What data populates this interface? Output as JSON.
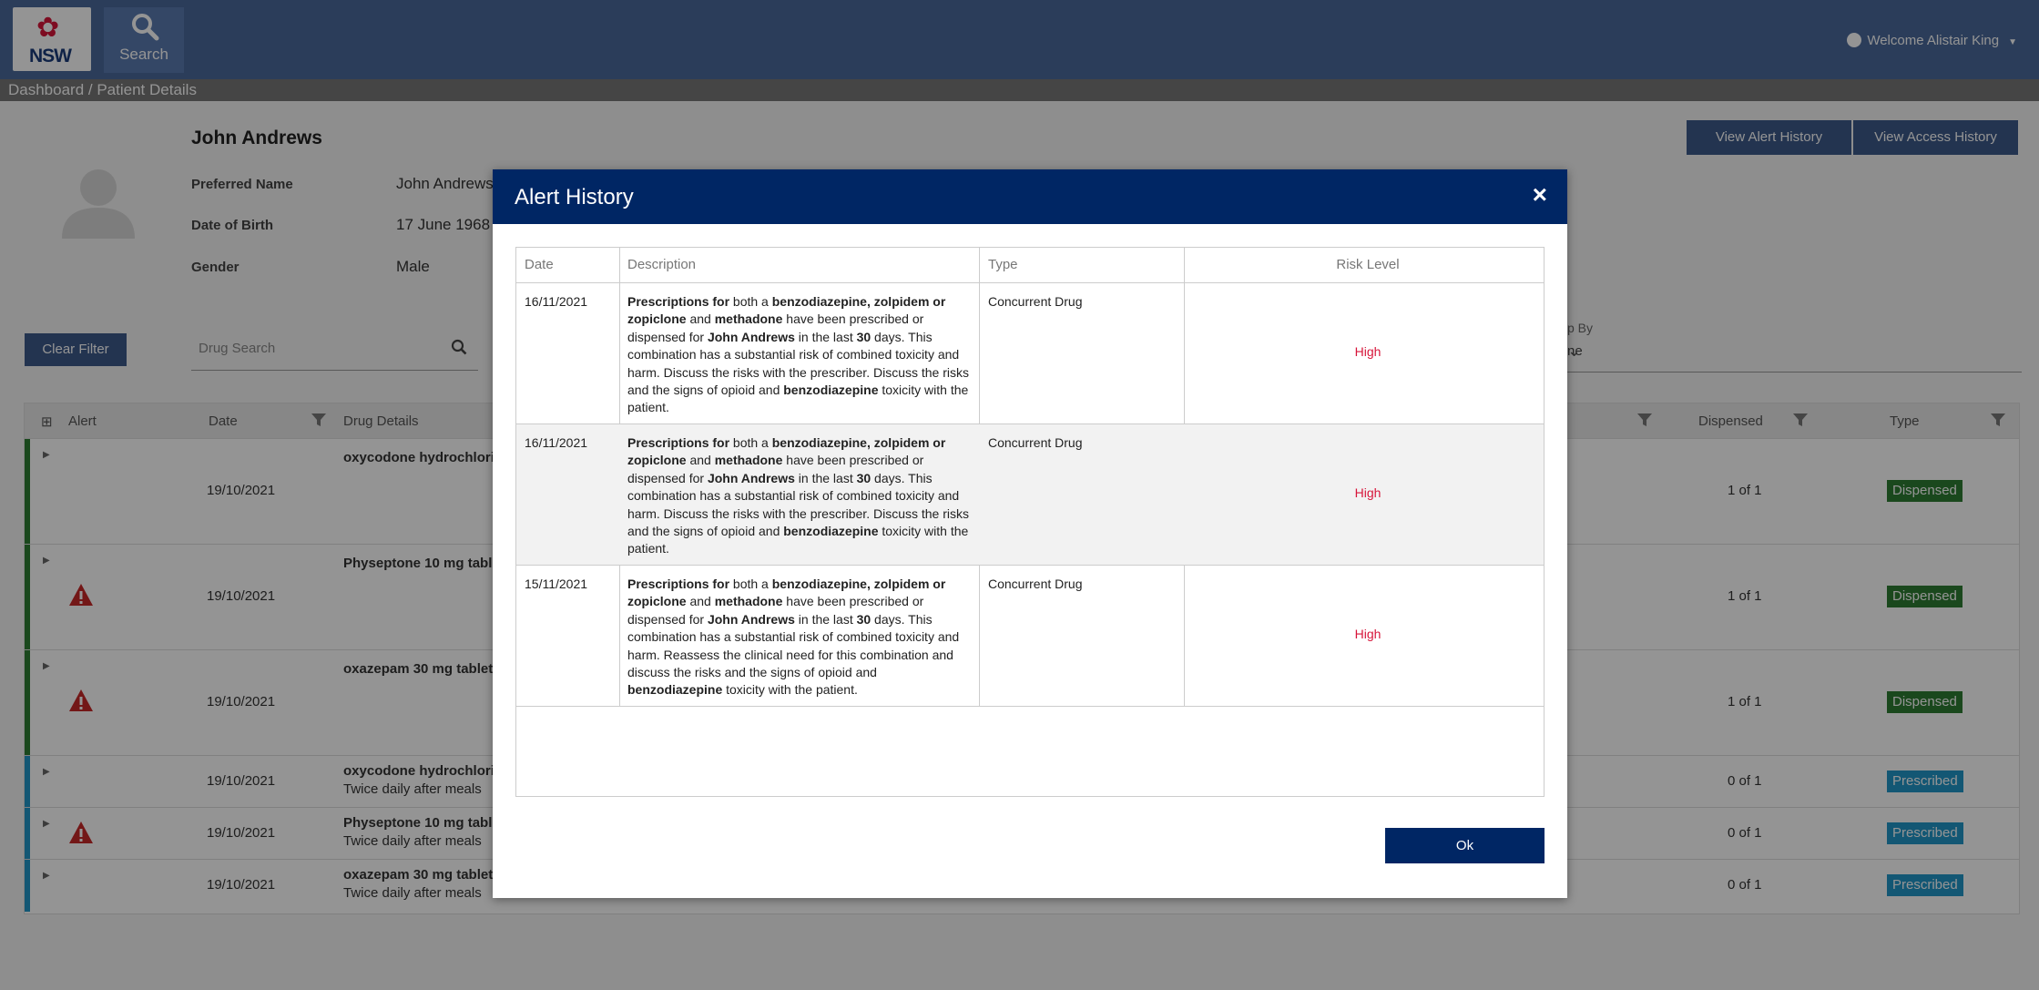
{
  "header": {
    "logo_text": "NSW",
    "search_label": "Search",
    "welcome_text": "Welcome Alistair King"
  },
  "breadcrumb": {
    "path": "Dashboard   / Patient Details"
  },
  "patient": {
    "name": "John Andrews",
    "preferred_name_label": "Preferred Name",
    "preferred_name": "John Andrews",
    "dob_label": "Date of Birth",
    "dob": "17 June 1968",
    "gender_label": "Gender",
    "gender": "Male"
  },
  "actions": {
    "view_alert_history": "View Alert History",
    "view_access_history": "View Access History",
    "clear_filter": "Clear Filter"
  },
  "filters": {
    "drug_search_placeholder": "Drug Search",
    "group_by_label": "p By",
    "group_by_value": "ne"
  },
  "table": {
    "columns": {
      "alert": "Alert",
      "date": "Date",
      "drug_details": "Drug Details",
      "dispensed": "Dispensed",
      "type": "Type"
    },
    "rows": [
      {
        "date": "19/10/2021",
        "drug": "oxycodone hydrochlorid",
        "instr": "",
        "dispensed": "1 of 1",
        "type": "Dispensed"
      },
      {
        "date": "19/10/2021",
        "drug": "Physeptone 10 mg table",
        "instr": "",
        "dispensed": "1 of 1",
        "type": "Dispensed"
      },
      {
        "date": "19/10/2021",
        "drug": "oxazepam 30 mg tablet,",
        "instr": "",
        "dispensed": "1 of 1",
        "type": "Dispensed"
      },
      {
        "date": "19/10/2021",
        "drug": "oxycodone hydrochlorid",
        "instr": "Twice daily after meals",
        "dispensed": "0 of 1",
        "type": "Prescribed"
      },
      {
        "date": "19/10/2021",
        "drug": "Physeptone 10 mg table",
        "instr": "Twice daily after meals",
        "dispensed": "0 of 1",
        "type": "Prescribed"
      },
      {
        "date": "19/10/2021",
        "drug": "oxazepam 30 mg tablet,",
        "instr": "Twice daily after meals",
        "dispensed": "0 of 1",
        "type": "Prescribed"
      }
    ]
  },
  "modal": {
    "title": "Alert History",
    "close": "×",
    "columns": {
      "date": "Date",
      "description": "Description",
      "type": "Type",
      "risk": "Risk Level"
    },
    "rows": [
      {
        "date": "16/11/2021",
        "desc": {
          "p1": "Prescriptions for",
          "p2": " both a ",
          "p3": "benzodiazepine, zolpidem or zopiclone",
          "p4": " and ",
          "p5": "methadone",
          "p6": " have been prescribed or dispensed for ",
          "p7": "John Andrews",
          "p8": " in the last ",
          "p9": "30",
          "p10": " days. This combination has a substantial risk of combined toxicity and harm. Discuss the risks with the prescriber. Discuss the risks and the signs of opioid and ",
          "p11": "benzodiazepine",
          "p12": " toxicity with the patient."
        },
        "type": "Concurrent Drug",
        "risk": "High"
      },
      {
        "date": "16/11/2021",
        "desc": {
          "p1": "Prescriptions for",
          "p2": " both a ",
          "p3": "benzodiazepine, zolpidem or zopiclone",
          "p4": " and ",
          "p5": "methadone",
          "p6": " have been prescribed or dispensed for ",
          "p7": "John Andrews",
          "p8": " in the last ",
          "p9": "30",
          "p10": " days. This combination has a substantial risk of combined toxicity and harm. Discuss the risks with the prescriber. Discuss the risks and the signs of opioid and ",
          "p11": "benzodiazepine",
          "p12": " toxicity with the patient."
        },
        "type": "Concurrent Drug",
        "risk": "High"
      },
      {
        "date": "15/11/2021",
        "desc": {
          "p1": "Prescriptions for",
          "p2": " both a ",
          "p3": "benzodiazepine, zolpidem or zopiclone",
          "p4": " and ",
          "p5": "methadone",
          "p6": " have been prescribed or dispensed for ",
          "p7": "John Andrews",
          "p8": " in the last ",
          "p9": "30",
          "p10": " days. This combination has a substantial risk of combined toxicity and harm. Reassess the clinical need for this combination and discuss the risks and the signs of opioid and ",
          "p11": "benzodiazepine",
          "p12": " toxicity with the patient."
        },
        "type": "Concurrent Drug",
        "risk": "High"
      }
    ],
    "ok_label": "Ok"
  },
  "colors": {
    "nav": "#4b6a9b",
    "modal_header": "#002664",
    "risk_high": "#d7153a",
    "dispensed_badge": "#2e7d32",
    "prescribed_badge": "#2196c9"
  }
}
